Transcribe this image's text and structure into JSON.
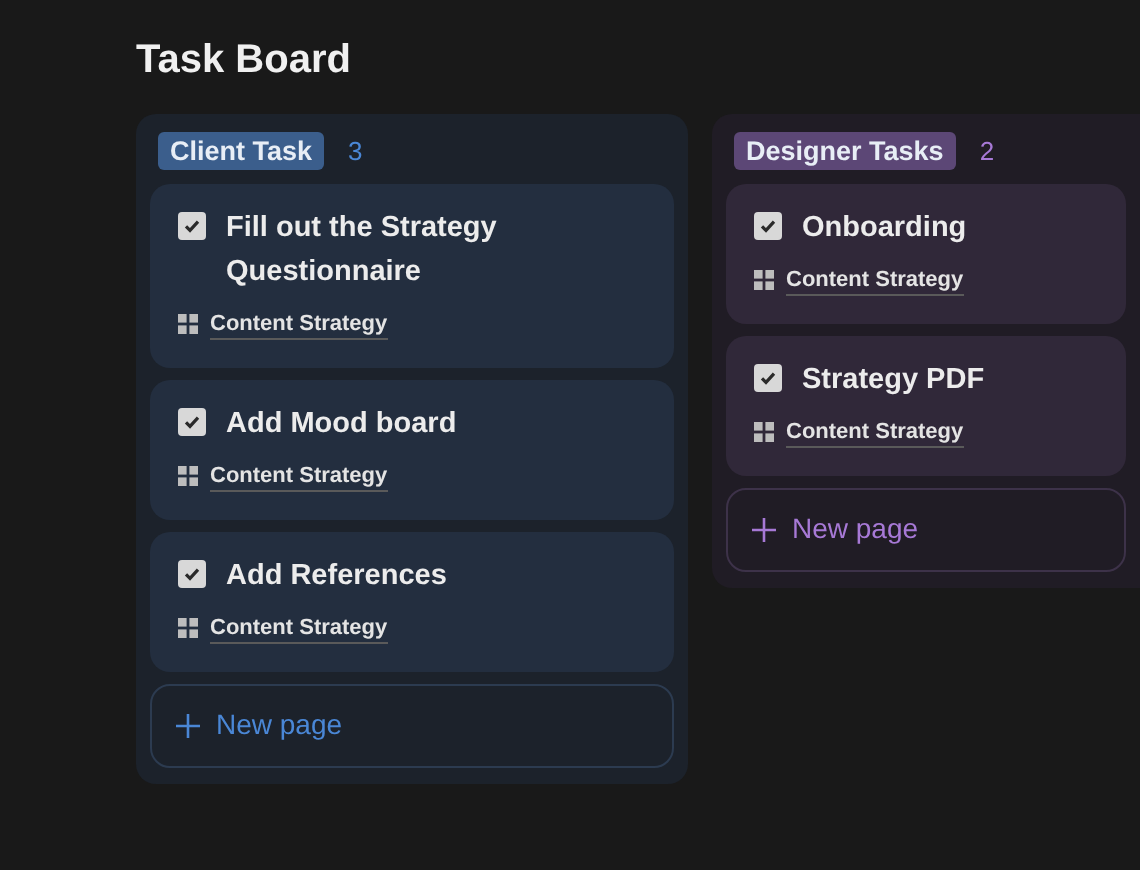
{
  "title": "Task Board",
  "columns": [
    {
      "name": "Client Task",
      "count": "3",
      "kind": "blue",
      "color": "#3b5e8c",
      "cards": [
        {
          "title": "Fill out the Strategy Questionnaire",
          "checked": true,
          "tag": "Content Strategy"
        },
        {
          "title": "Add Mood board",
          "checked": true,
          "tag": "Content Strategy"
        },
        {
          "title": "Add References",
          "checked": true,
          "tag": "Content Strategy"
        }
      ],
      "new_page": "New page"
    },
    {
      "name": "Designer Tasks",
      "count": "2",
      "kind": "purple",
      "color": "#5c4776",
      "cards": [
        {
          "title": "Onboarding",
          "checked": true,
          "tag": "Content Strategy"
        },
        {
          "title": "Strategy PDF",
          "checked": true,
          "tag": "Content Strategy"
        }
      ],
      "new_page": "New page"
    }
  ]
}
